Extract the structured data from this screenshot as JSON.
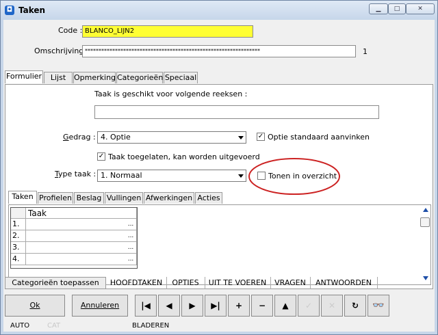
{
  "window": {
    "title": "Taken",
    "controls": [
      "▁",
      "□",
      "✕"
    ]
  },
  "form": {
    "code_label": "Code :",
    "code_value": "BLANCO_LIJN2",
    "omschrijving_label": "Omschrijving :",
    "omschrijving_value": "****************************************************************",
    "counter": "1"
  },
  "main_tabs": [
    "Formulier",
    "Lijst",
    "Opmerking",
    "Categorieën",
    "Speciaal"
  ],
  "formulier": {
    "reeksen_label": "Taak is geschikt voor volgende reeksen :",
    "reeksen_value": "",
    "gedrag_label": "Gedrag :",
    "gedrag_value": "4.  Optie",
    "optie_standaard_label": "Optie standaard aanvinken",
    "taak_toegelaten_label": "Taak toegelaten, kan worden uitgevoerd",
    "type_taak_label": "Type taak :",
    "type_taak_value": "1.  Normaal",
    "tonen_label": "Tonen in overzicht",
    "annotation_color": "#cc2222"
  },
  "sub_tabs": [
    "Taken",
    "Profielen",
    "Beslag",
    "Vullingen",
    "Afwerkingen",
    "Acties"
  ],
  "grid": {
    "column_header": "Taak",
    "rows": [
      "1.",
      "2.",
      "3.",
      "4."
    ],
    "ellipsis": "..."
  },
  "category_bar": {
    "apply_button": "Categorieën toepassen",
    "items": [
      "HOOFDTAKEN",
      "OPTIES",
      "UIT TE VOEREN",
      "VRAGEN",
      "ANTWOORDEN"
    ]
  },
  "buttons": {
    "ok": "Ok",
    "annuleren": "Annuleren"
  },
  "nav_icons": [
    "|◀",
    "◀",
    "▶",
    "▶|",
    "+",
    "−",
    "▲",
    "✓",
    "✕",
    "↻",
    "👓"
  ],
  "status": {
    "mode": "AUTO",
    "cat": "CAT",
    "state": "BLADEREN"
  }
}
